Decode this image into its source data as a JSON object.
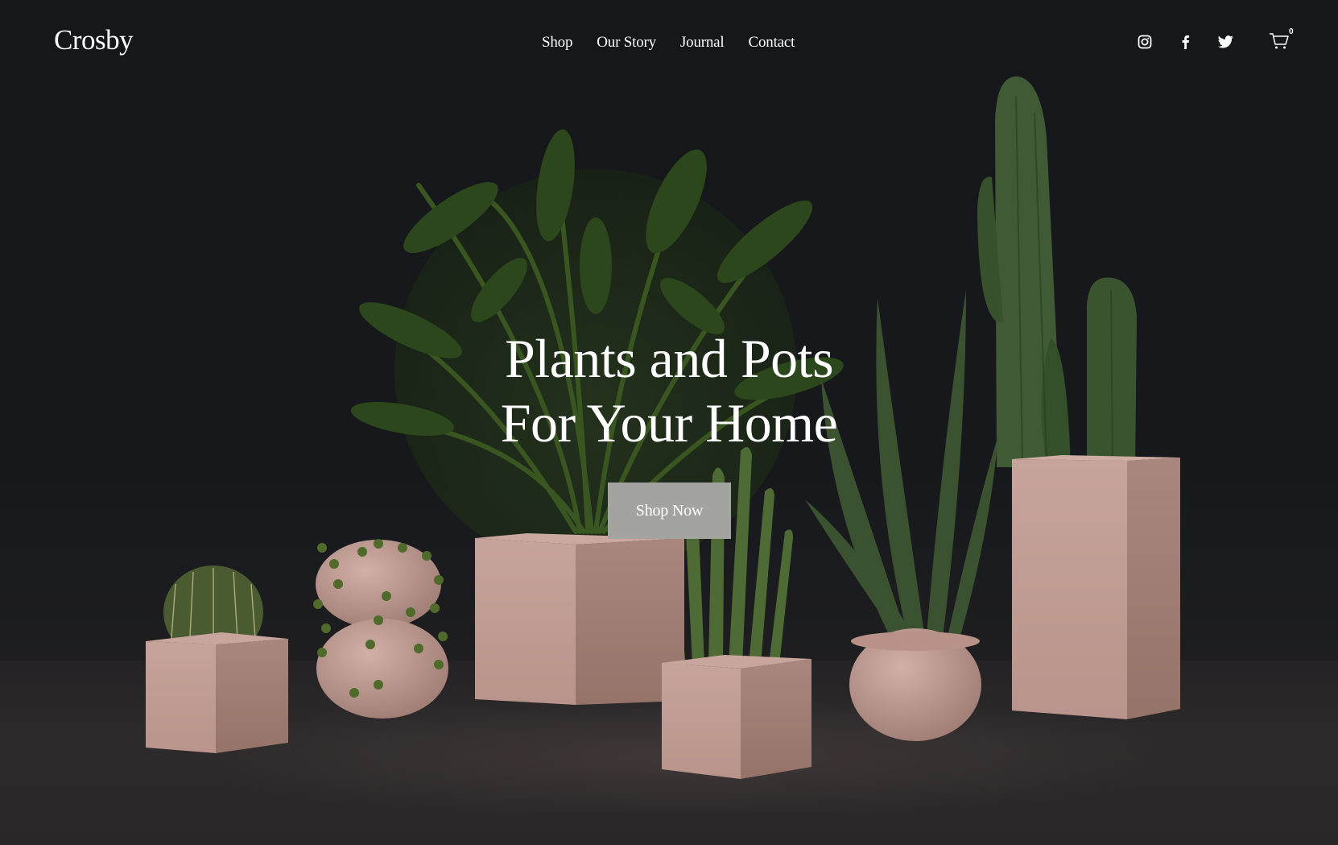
{
  "brand": {
    "logo_text": "Crosby"
  },
  "nav": {
    "items": [
      {
        "label": "Shop"
      },
      {
        "label": "Our Story"
      },
      {
        "label": "Journal"
      },
      {
        "label": "Contact"
      }
    ]
  },
  "social": {
    "icons": [
      "instagram-icon",
      "facebook-icon",
      "twitter-icon"
    ],
    "cart_count": "0"
  },
  "hero": {
    "headline_line1": "Plants and Pots",
    "headline_line2": "For Your Home",
    "cta_label": "Shop Now"
  },
  "colors": {
    "background": "#16181b",
    "pot": "#c9a89f",
    "button": "#a3a3a0",
    "text": "#ffffff"
  }
}
